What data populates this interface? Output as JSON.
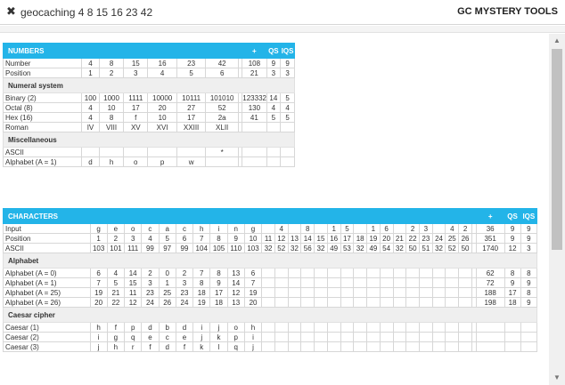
{
  "window": {
    "title": "geocaching 4 8 15 16 23 42",
    "brand": "GC MYSTERY TOOLS",
    "close_icon": "✖"
  },
  "numbers": {
    "heading": "NUMBERS",
    "sum_label": "+",
    "qs_label": "QS",
    "iqs_label": "IQS",
    "rows": [
      {
        "label": "Number",
        "cells": [
          "4",
          "8",
          "15",
          "16",
          "23",
          "42"
        ],
        "stats": [
          "108",
          "9",
          "9"
        ]
      },
      {
        "label": "Position",
        "cells": [
          "1",
          "2",
          "3",
          "4",
          "5",
          "6"
        ],
        "stats": [
          "21",
          "3",
          "3"
        ]
      }
    ],
    "numeral_heading": "Numeral system",
    "numeral_rows": [
      {
        "label": "Binary (2)",
        "cells": [
          "100",
          "1000",
          "1111",
          "10000",
          "10111",
          "101010"
        ],
        "stats": [
          "123332",
          "14",
          "5"
        ]
      },
      {
        "label": "Octal (8)",
        "cells": [
          "4",
          "10",
          "17",
          "20",
          "27",
          "52"
        ],
        "stats": [
          "130",
          "4",
          "4"
        ]
      },
      {
        "label": "Hex (16)",
        "cells": [
          "4",
          "8",
          "f",
          "10",
          "17",
          "2a"
        ],
        "stats": [
          "41",
          "5",
          "5"
        ]
      },
      {
        "label": "Roman",
        "cells": [
          "IV",
          "VIII",
          "XV",
          "XVI",
          "XXIII",
          "XLII"
        ],
        "stats": [
          "",
          "",
          ""
        ]
      }
    ],
    "misc_heading": "Miscellaneous",
    "misc_rows": [
      {
        "label": "ASCII",
        "cells": [
          "",
          "",
          "",
          "",
          "",
          "*"
        ],
        "stats": [
          "",
          "",
          ""
        ]
      },
      {
        "label": "Alphabet (A = 1)",
        "cells": [
          "d",
          "h",
          "o",
          "p",
          "w",
          ""
        ],
        "stats": [
          "",
          "",
          ""
        ]
      }
    ]
  },
  "characters": {
    "heading": "CHARACTERS",
    "sum_label": "+",
    "qs_label": "QS",
    "iqs_label": "IQS",
    "rows": [
      {
        "label": "Input",
        "cells": [
          "g",
          "e",
          "o",
          "c",
          "a",
          "c",
          "h",
          "i",
          "n",
          "g",
          "",
          "4",
          "",
          "8",
          "",
          "1",
          "5",
          "",
          "1",
          "6",
          "",
          "2",
          "3",
          "",
          "4",
          "2"
        ],
        "stats": [
          "36",
          "9",
          "9"
        ]
      },
      {
        "label": "Position",
        "cells": [
          "1",
          "2",
          "3",
          "4",
          "5",
          "6",
          "7",
          "8",
          "9",
          "10",
          "11",
          "12",
          "13",
          "14",
          "15",
          "16",
          "17",
          "18",
          "19",
          "20",
          "21",
          "22",
          "23",
          "24",
          "25",
          "26"
        ],
        "stats": [
          "351",
          "9",
          "9"
        ]
      },
      {
        "label": "ASCII",
        "cells": [
          "103",
          "101",
          "111",
          "99",
          "97",
          "99",
          "104",
          "105",
          "110",
          "103",
          "32",
          "52",
          "32",
          "56",
          "32",
          "49",
          "53",
          "32",
          "49",
          "54",
          "32",
          "50",
          "51",
          "32",
          "52",
          "50"
        ],
        "stats": [
          "1740",
          "12",
          "3"
        ]
      }
    ],
    "alphabet_heading": "Alphabet",
    "alphabet_rows": [
      {
        "label": "Alphabet (A = 0)",
        "cells": [
          "6",
          "4",
          "14",
          "2",
          "0",
          "2",
          "7",
          "8",
          "13",
          "6",
          "",
          "",
          "",
          "",
          "",
          "",
          "",
          "",
          "",
          "",
          "",
          "",
          "",
          "",
          "",
          ""
        ],
        "stats": [
          "62",
          "8",
          "8"
        ]
      },
      {
        "label": "Alphabet (A = 1)",
        "cells": [
          "7",
          "5",
          "15",
          "3",
          "1",
          "3",
          "8",
          "9",
          "14",
          "7",
          "",
          "",
          "",
          "",
          "",
          "",
          "",
          "",
          "",
          "",
          "",
          "",
          "",
          "",
          "",
          ""
        ],
        "stats": [
          "72",
          "9",
          "9"
        ]
      },
      {
        "label": "Alphabet (A = 25)",
        "cells": [
          "19",
          "21",
          "11",
          "23",
          "25",
          "23",
          "18",
          "17",
          "12",
          "19",
          "",
          "",
          "",
          "",
          "",
          "",
          "",
          "",
          "",
          "",
          "",
          "",
          "",
          "",
          "",
          ""
        ],
        "stats": [
          "188",
          "17",
          "8"
        ]
      },
      {
        "label": "Alphabet (A = 26)",
        "cells": [
          "20",
          "22",
          "12",
          "24",
          "26",
          "24",
          "19",
          "18",
          "13",
          "20",
          "",
          "",
          "",
          "",
          "",
          "",
          "",
          "",
          "",
          "",
          "",
          "",
          "",
          "",
          "",
          ""
        ],
        "stats": [
          "198",
          "18",
          "9"
        ]
      }
    ],
    "caesar_heading": "Caesar cipher",
    "caesar_rows": [
      {
        "label": "Caesar (1)",
        "cells": [
          "h",
          "f",
          "p",
          "d",
          "b",
          "d",
          "i",
          "j",
          "o",
          "h",
          "",
          "",
          "",
          "",
          "",
          "",
          "",
          "",
          "",
          "",
          "",
          "",
          "",
          "",
          "",
          ""
        ],
        "stats": [
          "",
          "",
          ""
        ]
      },
      {
        "label": "Caesar (2)",
        "cells": [
          "i",
          "g",
          "q",
          "e",
          "c",
          "e",
          "j",
          "k",
          "p",
          "i",
          "",
          "",
          "",
          "",
          "",
          "",
          "",
          "",
          "",
          "",
          "",
          "",
          "",
          "",
          "",
          ""
        ],
        "stats": [
          "",
          "",
          ""
        ]
      },
      {
        "label": "Caesar (3)",
        "cells": [
          "j",
          "h",
          "r",
          "f",
          "d",
          "f",
          "k",
          "l",
          "q",
          "j",
          "",
          "",
          "",
          "",
          "",
          "",
          "",
          "",
          "",
          "",
          "",
          "",
          "",
          "",
          "",
          ""
        ],
        "stats": [
          "",
          "",
          ""
        ]
      }
    ]
  },
  "colors": {
    "header_blue": "#23b4e8",
    "subheader_gray": "#efefef",
    "grid_line": "#d7d7d7"
  }
}
